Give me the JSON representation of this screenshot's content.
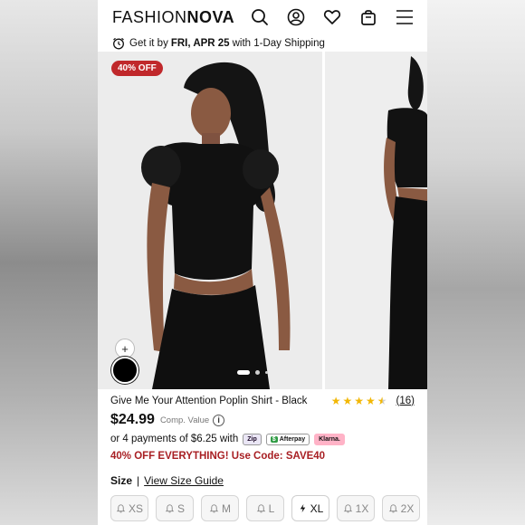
{
  "header": {
    "logo_light": "FASHION",
    "logo_bold": "NOVA",
    "icons": [
      "search-icon",
      "account-icon",
      "wishlist-heart-icon",
      "shopping-bag-icon",
      "menu-icon"
    ]
  },
  "shipping": {
    "prefix": "Get it by",
    "date": "FRI, APR 25",
    "suffix": "with 1-Day Shipping"
  },
  "gallery": {
    "badge": "40% OFF",
    "add_color_symbol": "+",
    "selected_color": "#000000",
    "slide_count": 3,
    "active_slide": 1
  },
  "product": {
    "name": "Give Me Your Attention Poplin Shirt - Black",
    "rating": 4.5,
    "review_count": "(16)",
    "price": "$24.99",
    "comp_value_label": "Comp. Value",
    "installments_text": "or 4 payments of $6.25 with",
    "payment_providers": [
      "Zip",
      "Afterpay",
      "Klarna."
    ],
    "promo": "40% OFF EVERYTHING! Use Code: SAVE40"
  },
  "size": {
    "label": "Size",
    "guide_link": "View Size Guide",
    "options": [
      {
        "label": "XS",
        "status": "notify"
      },
      {
        "label": "S",
        "status": "notify"
      },
      {
        "label": "M",
        "status": "notify"
      },
      {
        "label": "L",
        "status": "notify"
      },
      {
        "label": "XL",
        "status": "low-stock"
      },
      {
        "label": "1X",
        "status": "notify"
      },
      {
        "label": "2X",
        "status": "notify"
      }
    ]
  },
  "colors": {
    "promo_red": "#a81f23",
    "badge_red": "#c0282b",
    "star_gold": "#f2b705"
  }
}
